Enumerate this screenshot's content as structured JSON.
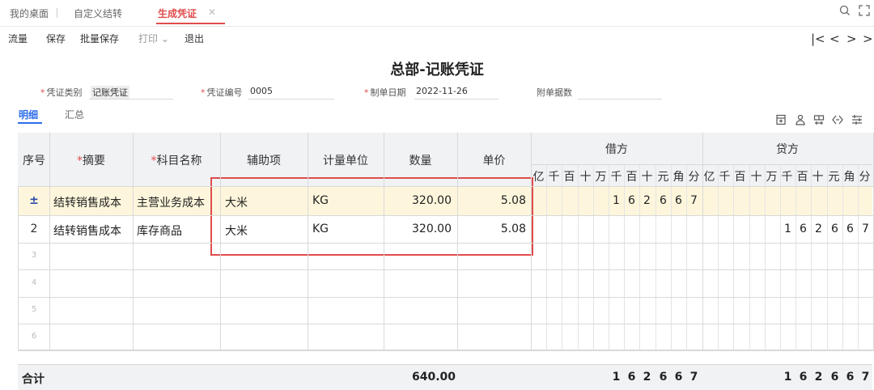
{
  "tabs": [
    {
      "label": "我的桌面"
    },
    {
      "label": "自定义结转"
    },
    {
      "label": "生成凭证"
    }
  ],
  "toolbar": {
    "flow": "流量",
    "save": "保存",
    "batch_save": "批量保存",
    "print": "打印",
    "print_caret": "⌄",
    "exit": "退出"
  },
  "nav": {
    "first": "|<",
    "prev": "<",
    "next": ">",
    "last": ">|"
  },
  "voucher": {
    "title": "总部-记账凭证",
    "type_label": "凭证类别",
    "type_value": "记账凭证",
    "no_label": "凭证编号",
    "no_value": "0005",
    "date_label": "制单日期",
    "date_value": "2022-11-26",
    "attach_label": "附单据数"
  },
  "view_tabs": {
    "detail": "明细",
    "summary": "汇总"
  },
  "grid": {
    "headers": {
      "seq": "序号",
      "summary": "摘要",
      "account": "科目名称",
      "aux": "辅助项",
      "unit": "计量单位",
      "qty": "数量",
      "price": "单价",
      "debit": "借方",
      "credit": "贷方"
    },
    "digit_units": [
      "亿",
      "千",
      "百",
      "十",
      "万",
      "千",
      "百",
      "十",
      "元",
      "角",
      "分"
    ],
    "rows": [
      {
        "summary": "结转销售成本",
        "account": "主营业务成本",
        "aux": "大米",
        "unit": "KG",
        "qty": "320.00",
        "price": "5.08",
        "debit": [
          "1",
          "6",
          "2",
          "6",
          "6",
          "7"
        ],
        "credit": []
      },
      {
        "seq": "2",
        "summary": "结转销售成本",
        "account": "库存商品",
        "aux": "大米",
        "unit": "KG",
        "qty": "320.00",
        "price": "5.08",
        "debit": [],
        "credit": [
          "1",
          "6",
          "2",
          "6",
          "6",
          "7"
        ]
      }
    ],
    "empty_rows": [
      "3",
      "4",
      "5",
      "6"
    ],
    "row1_icon": "insert-row-icon"
  },
  "total": {
    "label": "合计",
    "qty": "640.00",
    "debit": [
      "1",
      "6",
      "2",
      "6",
      "6",
      "7"
    ],
    "credit": [
      "1",
      "6",
      "2",
      "6",
      "6",
      "7"
    ]
  },
  "colors": {
    "accent": "#e04c4c",
    "link": "#2b6de8",
    "header_bg": "#f1f2f4",
    "selected_row": "#fdf6dc"
  }
}
